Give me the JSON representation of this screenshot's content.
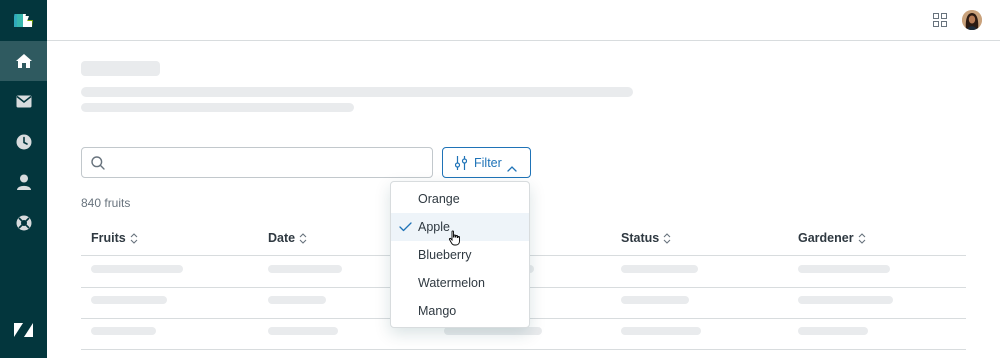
{
  "sidebar": {
    "logo_icon": "zendesk-product-icon",
    "items": [
      {
        "icon": "home-icon",
        "active": true
      },
      {
        "icon": "mail-icon",
        "active": false
      },
      {
        "icon": "clock-icon",
        "active": false
      },
      {
        "icon": "user-icon",
        "active": false
      },
      {
        "icon": "support-icon",
        "active": false
      }
    ],
    "bottom_icon": "zendesk-logo-icon"
  },
  "header": {
    "apps_icon": "grid-icon",
    "avatar": "user-avatar"
  },
  "search": {
    "value": "",
    "placeholder": ""
  },
  "filter": {
    "label": "Filter",
    "expanded": true
  },
  "count_label": "840 fruits",
  "table": {
    "columns": [
      "Fruits",
      "Date",
      "",
      "Status",
      "Gardener"
    ]
  },
  "dropdown": {
    "options": [
      {
        "label": "Orange",
        "selected": false
      },
      {
        "label": "Apple",
        "selected": true
      },
      {
        "label": "Blueberry",
        "selected": false
      },
      {
        "label": "Watermelon",
        "selected": false
      },
      {
        "label": "Mango",
        "selected": false
      }
    ]
  },
  "colors": {
    "sidebar_bg": "#03363d",
    "accent": "#1f73b7",
    "skeleton": "#e9ebed"
  }
}
